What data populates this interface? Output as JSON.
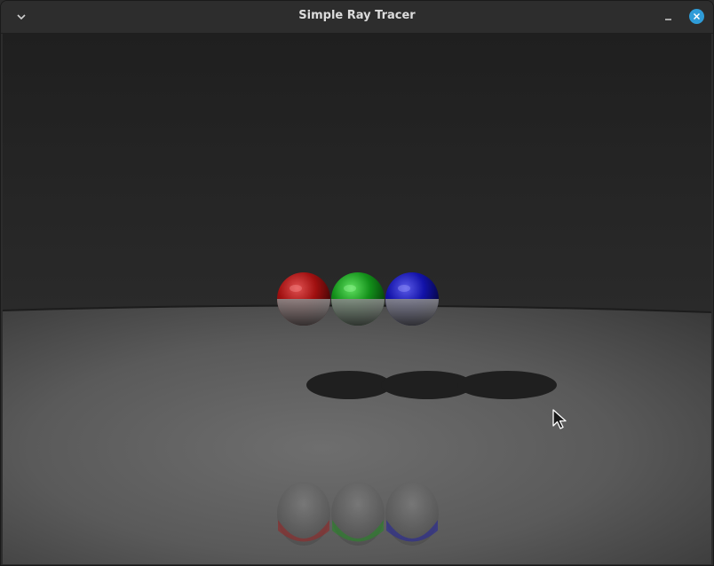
{
  "window": {
    "title": "Simple Ray Tracer"
  },
  "titlebar": {
    "menu_icon": "chevron-down-icon",
    "minimize_icon": "minimize-icon",
    "close_icon": "close-icon",
    "close_color": "#2f9cd8"
  },
  "scene": {
    "background_wall": "#232323",
    "floor_color": "#5c5c5c",
    "spheres": [
      {
        "name": "red",
        "color": "#b01818"
      },
      {
        "name": "green",
        "color": "#1fa01f"
      },
      {
        "name": "blue",
        "color": "#1a1ab8"
      }
    ]
  },
  "cursor": {
    "icon": "mouse-pointer-icon"
  }
}
